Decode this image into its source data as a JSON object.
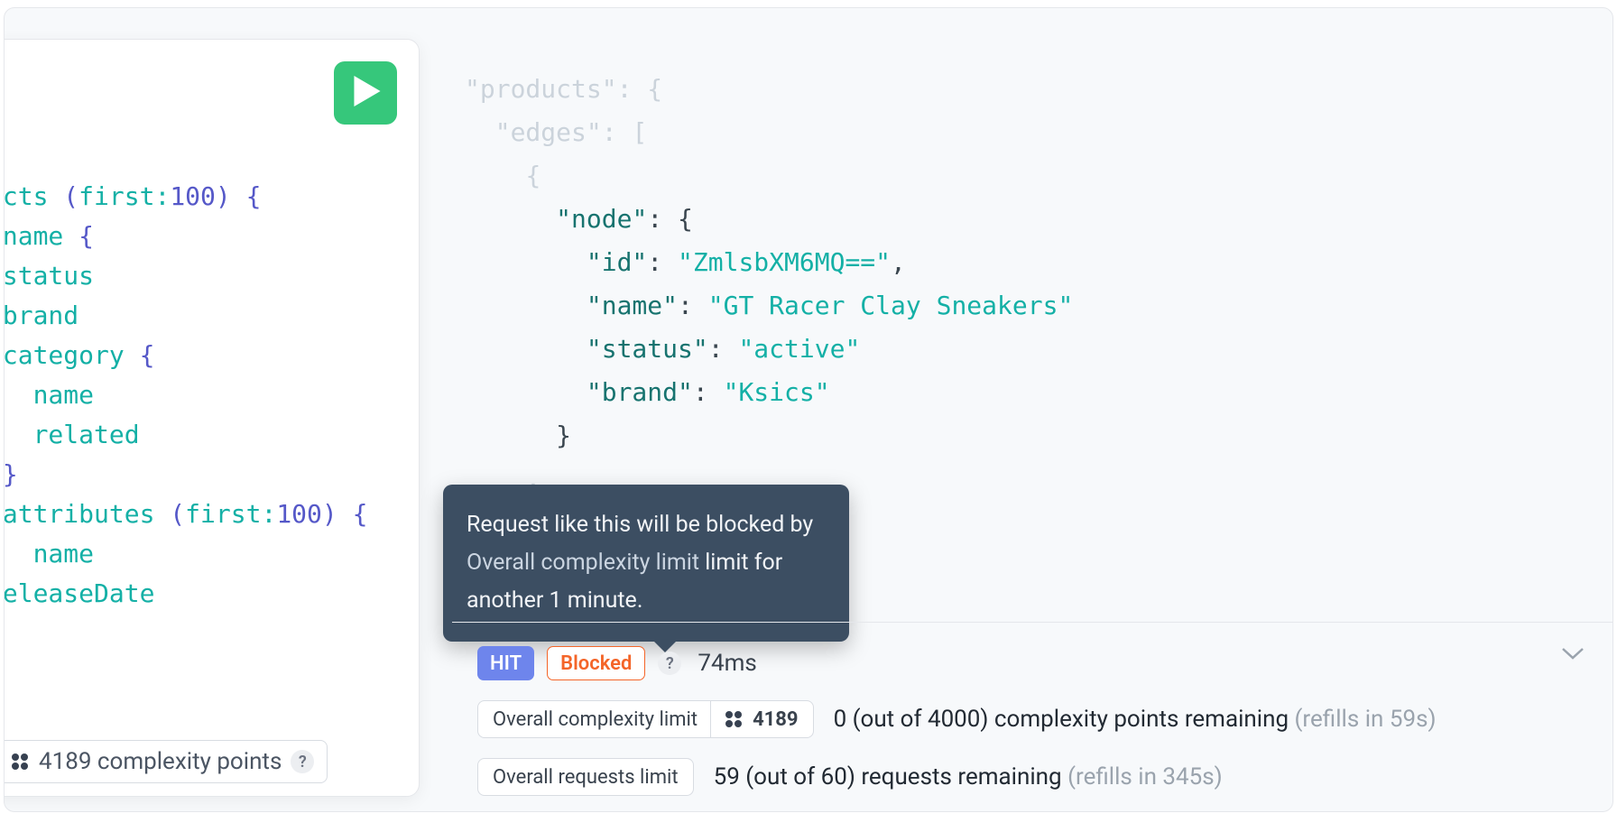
{
  "query": {
    "lines": [
      {
        "text": "ucts ",
        "bracket": "(",
        "inner": "first:",
        "num": "100",
        "bracket2": ") {"
      },
      {
        "indent": 1,
        "text": "name ",
        "bracket": "{"
      },
      {
        "indent": 1,
        "text": "status"
      },
      {
        "indent": 1,
        "text": "brand"
      },
      {
        "indent": 1,
        "text": "category ",
        "bracket": "{"
      },
      {
        "indent": 2,
        "text": "name"
      },
      {
        "indent": 2,
        "text": "related"
      },
      {
        "indent": 1,
        "bracket": "}"
      },
      {
        "indent": 1,
        "text": "attributes ",
        "bracket": "(",
        "inner": "first:",
        "num": "100",
        "bracket2": ") {"
      },
      {
        "indent": 2,
        "text": "name"
      },
      {
        "indent": 0,
        "text": "releaseDate"
      }
    ],
    "complexity_points": "4189 complexity points"
  },
  "response": {
    "products_key": "\"products\"",
    "edges_key": "\"edges\"",
    "node_key": "\"node\"",
    "fields": {
      "id_key": "\"id\"",
      "id_val": "\"ZmlsbXM6MQ==\"",
      "name_key": "\"name\"",
      "name_val": "\"GT Racer Clay Sneakers\"",
      "status_key": "\"status\"",
      "status_val": "\"active\"",
      "brand_key": "\"brand\"",
      "brand_val": "\"Ksics\""
    }
  },
  "tooltip": {
    "part1": "Request like this will be blocked by ",
    "dim": "Overall complexity limit",
    "part2": " limit for another 1 minute."
  },
  "footer": {
    "hit": "HIT",
    "blocked": "Blocked",
    "ms": "74ms",
    "complexity_limit_label": "Overall complexity limit",
    "complexity_limit_points": "4189",
    "complexity_remaining": "0 (out of 4000) complexity points remaining ",
    "complexity_refill": "(refills in 59s)",
    "requests_limit_label": "Overall requests limit",
    "requests_remaining": "59 (out of 60) requests remaining ",
    "requests_refill": "(refills in 345s)"
  }
}
